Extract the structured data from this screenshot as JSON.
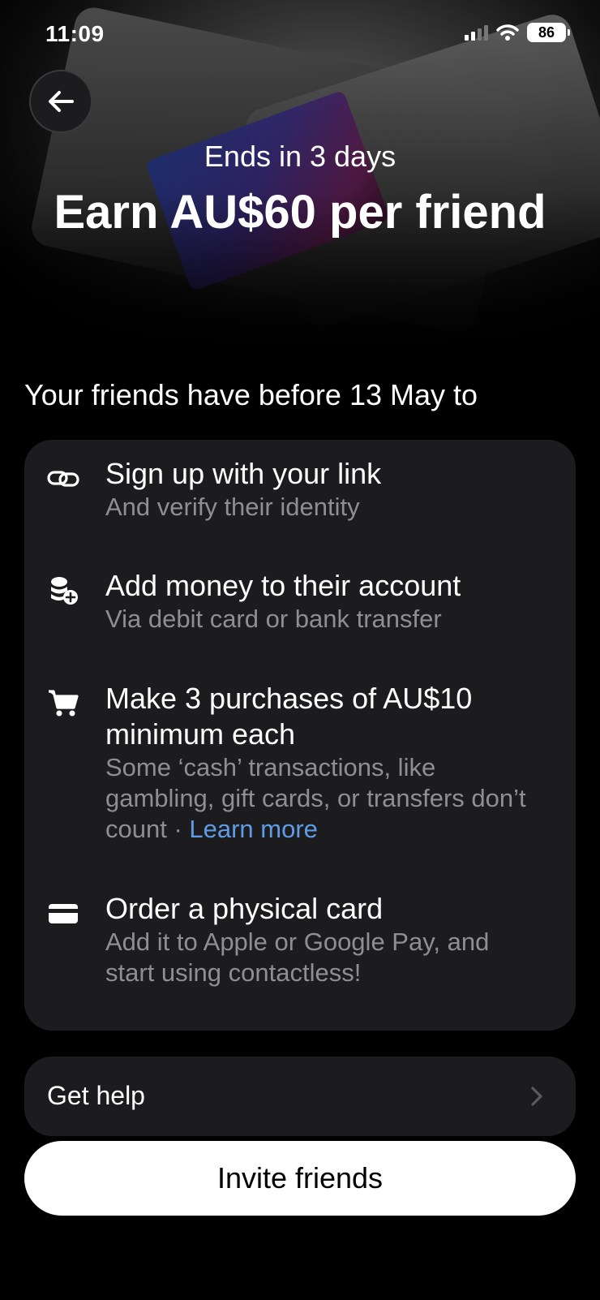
{
  "status_bar": {
    "time": "11:09",
    "battery": "86"
  },
  "hero": {
    "subtitle": "Ends in 3 days",
    "title": "Earn AU$60 per friend"
  },
  "intro": "Your friends have before 13 May to",
  "steps": [
    {
      "icon": "link-icon",
      "title": "Sign up with your link",
      "desc": "And verify their identity"
    },
    {
      "icon": "coins-add-icon",
      "title": "Add money to their account",
      "desc": "Via debit card or bank transfer"
    },
    {
      "icon": "cart-icon",
      "title": "Make 3 purchases of AU$10 minimum each",
      "desc": "Some ‘cash’ transactions, like gambling, gift cards, or transfers don’t count · ",
      "link": "Learn more"
    },
    {
      "icon": "card-icon",
      "title": "Order a physical card",
      "desc": "Add it to Apple or Google Pay, and start using contactless!"
    }
  ],
  "help": {
    "label": "Get help"
  },
  "cta": {
    "label": "Invite friends"
  }
}
